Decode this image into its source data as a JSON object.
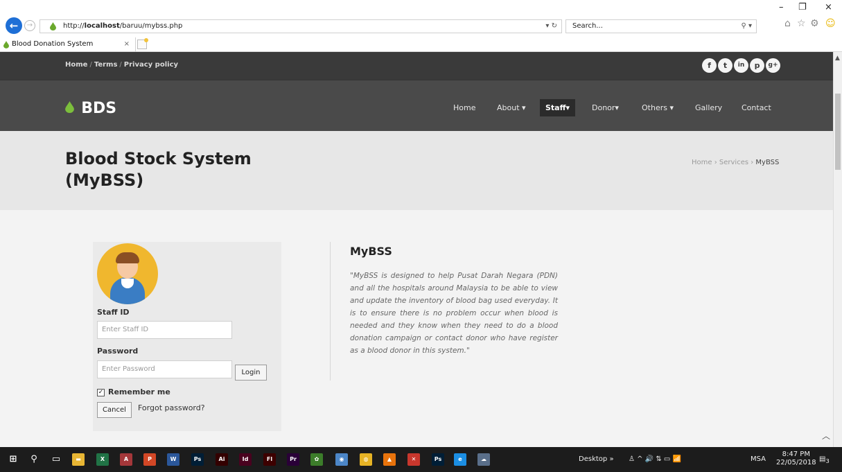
{
  "browser": {
    "url_prefix": "http://",
    "url_host": "localhost",
    "url_path": "/baruu/mybss.php",
    "url_tools": "▾ ↻",
    "search_placeholder": "Search...",
    "search_icon": "⚲ ▾",
    "tab_title": "Blood Donation System",
    "tab_close": "×",
    "back_icon": "←",
    "forward_icon": "→",
    "window_minimize": "–",
    "window_restore": "❐",
    "window_close": "×",
    "toolbar_home": "⌂",
    "toolbar_favorites": "☆",
    "toolbar_settings": "⚙",
    "toolbar_smiley": "☺"
  },
  "topbar": {
    "links": [
      "Home",
      "Terms",
      "Privacy policy"
    ],
    "separator": "/",
    "socials": [
      "f",
      "t",
      "in",
      "p",
      "g+"
    ]
  },
  "nav": {
    "logo_drop": "💧",
    "logo": "BDS",
    "items": [
      "Home",
      "About ▾",
      "Staff▾",
      "Donor▾",
      "Others ▾",
      "Gallery",
      "Contact"
    ],
    "active_index": 2
  },
  "page": {
    "title": "Blood Stock System (MyBSS)",
    "breadcrumb_prefix": "Home › Services › ",
    "breadcrumb_current": "MyBSS"
  },
  "login": {
    "staff_id_label": "Staff ID",
    "staff_id_placeholder": "Enter Staff ID",
    "password_label": "Password",
    "password_placeholder": "Enter Password",
    "login_button": "Login",
    "remember_label": "Remember me",
    "remember_checked": true,
    "cancel_button": "Cancel",
    "forgot_link": "Forgot password?"
  },
  "about": {
    "heading": "MyBSS",
    "text": "\"MyBSS is designed to help Pusat Darah Negara (PDN) and all the hospitals around Malaysia to be able to view and update the inventory of blood bag used everyday. It is to ensure there is no problem occur when blood is needed and they know when they need to do a blood donation campaign or contact donor who have register as a blood donor in this system.\""
  },
  "taskbar": {
    "apps": [
      {
        "name": "windows-start-icon",
        "glyph": "⊞",
        "color": "#1c1c1c"
      },
      {
        "name": "search-icon",
        "glyph": "⚲",
        "color": "#1c1c1c"
      },
      {
        "name": "task-view-icon",
        "glyph": "▭",
        "color": "#1c1c1c"
      },
      {
        "name": "file-explorer-icon",
        "glyph": "▬",
        "color": "#e8b634"
      },
      {
        "name": "excel-icon",
        "glyph": "X",
        "color": "#217346"
      },
      {
        "name": "access-icon",
        "glyph": "A",
        "color": "#a4373a"
      },
      {
        "name": "powerpoint-icon",
        "glyph": "P",
        "color": "#d24726"
      },
      {
        "name": "word-icon",
        "glyph": "W",
        "color": "#2b579a"
      },
      {
        "name": "photoshop-icon",
        "glyph": "Ps",
        "color": "#001e36"
      },
      {
        "name": "illustrator-icon",
        "glyph": "Ai",
        "color": "#330000"
      },
      {
        "name": "indesign-icon",
        "glyph": "Id",
        "color": "#49021f"
      },
      {
        "name": "flash-icon",
        "glyph": "Fl",
        "color": "#3d0000"
      },
      {
        "name": "premiere-icon",
        "glyph": "Pr",
        "color": "#2a0038"
      },
      {
        "name": "game-icon",
        "glyph": "✿",
        "color": "#3c7d2a"
      },
      {
        "name": "browser-globe-icon",
        "glyph": "◉",
        "color": "#4c86c7"
      },
      {
        "name": "chrome-icon",
        "glyph": "◍",
        "color": "#e6b325"
      },
      {
        "name": "vlc-icon",
        "glyph": "▲",
        "color": "#e8730c"
      },
      {
        "name": "xampp-icon",
        "glyph": "✕",
        "color": "#c8372d"
      },
      {
        "name": "photoshop-2-icon",
        "glyph": "Ps",
        "color": "#001e36"
      },
      {
        "name": "internet-explorer-icon",
        "glyph": "e",
        "color": "#1b8ee3"
      },
      {
        "name": "network-app-icon",
        "glyph": "☁",
        "color": "#5a6f8a"
      }
    ],
    "desktop_label": "Desktop",
    "desktop_arrow": "»",
    "tray": "♙  ^  🔊  ⇅  ▭  📶",
    "language": "MSA",
    "time": "8:47 PM",
    "date": "22/05/2018",
    "notification_count": "3"
  }
}
